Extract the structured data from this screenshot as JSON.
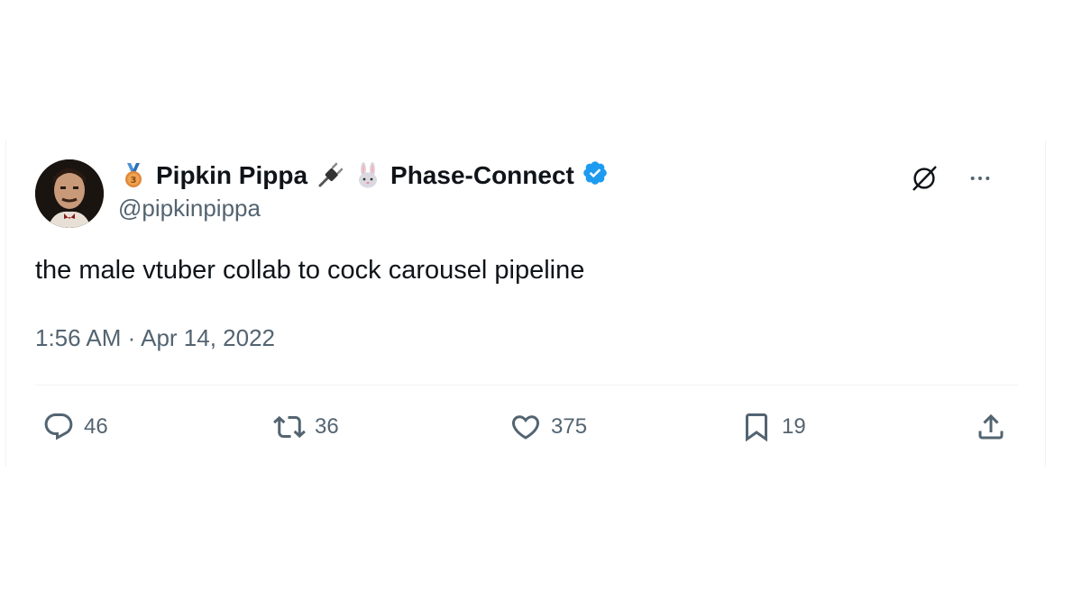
{
  "tweet": {
    "display_name": "Pipkin Pippa",
    "affiliation": "Phase-Connect",
    "handle": "@pipkinpippa",
    "text": "the male vtuber collab to cock carousel pipeline",
    "time": "1:56 AM",
    "separator": "·",
    "date": "Apr 14, 2022",
    "verified_color": "#1d9bf0"
  },
  "header_icons": [
    "medal-emoji",
    "plug-emoji",
    "rabbit-emoji",
    "verified-badge-icon",
    "grok-icon",
    "more-icon"
  ],
  "actions": {
    "replies": "46",
    "reposts": "36",
    "likes": "375",
    "bookmarks": "19"
  }
}
